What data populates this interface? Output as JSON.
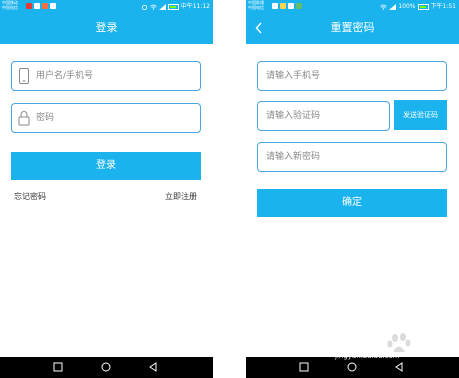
{
  "colors": {
    "primary": "#1bb3ee",
    "border": "#4aa8e0",
    "navbar": "#000000"
  },
  "login_screen": {
    "status": {
      "carrier": "中国移动\n中国电信",
      "time": "中午11:12"
    },
    "title": "登录",
    "username": {
      "placeholder": "用户名/手机号",
      "icon": "phone-icon"
    },
    "password": {
      "placeholder": "密码",
      "icon": "lock-icon"
    },
    "login_button": "登录",
    "forgot_link": "忘记密码",
    "register_link": "立即注册"
  },
  "reset_screen": {
    "status": {
      "carrier": "中国联通\n中国电信",
      "battery": "100%",
      "time": "下午1:51"
    },
    "title": "重置密码",
    "phone": {
      "placeholder": "请输入手机号"
    },
    "code": {
      "placeholder": "请输入验证码"
    },
    "send_code_button": "发送验证码",
    "new_password": {
      "placeholder": "请输入新密码"
    },
    "confirm_button": "确定"
  },
  "navbar_icons": [
    "square-icon",
    "circle-icon",
    "triangle-back-icon"
  ],
  "watermark": {
    "text": "jingyan.baidu.com",
    "icon": "baidu-paw-icon"
  }
}
